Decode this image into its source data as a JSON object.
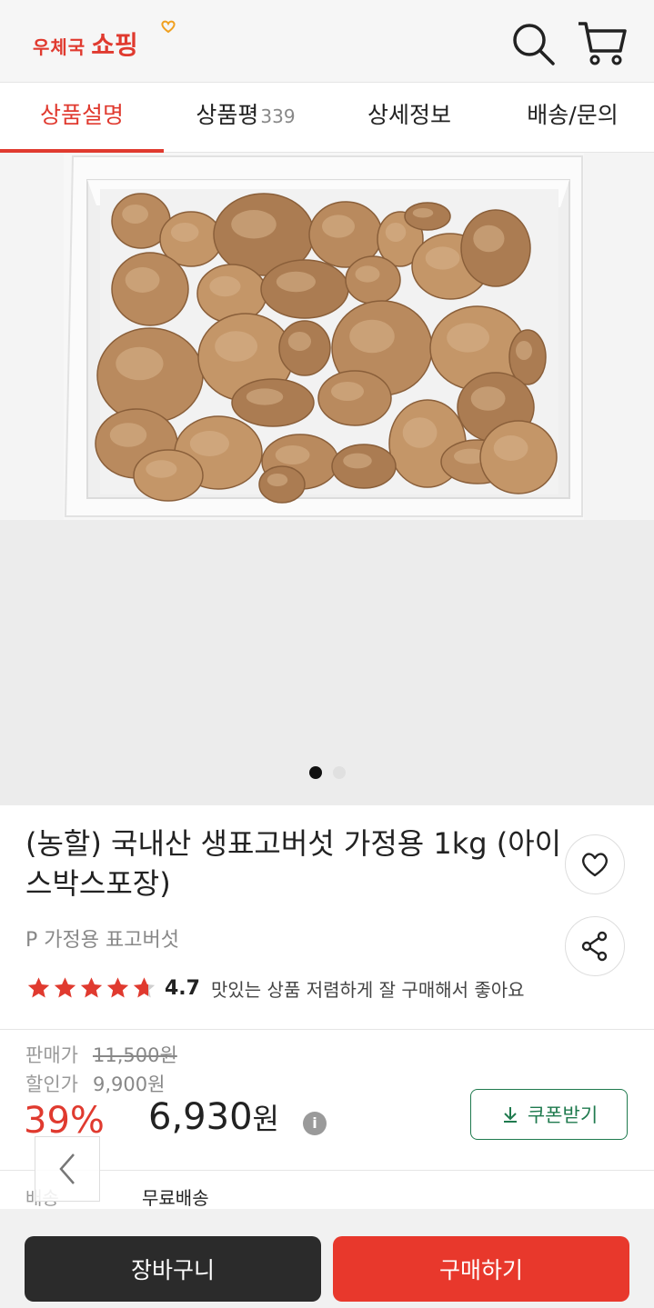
{
  "header": {
    "logo_small": "우체국",
    "logo_big": "쇼핑",
    "search_icon": "search-icon",
    "cart_icon": "cart-icon"
  },
  "tabs": [
    {
      "label": "상품설명",
      "active": true
    },
    {
      "label": "상품평",
      "count": "339"
    },
    {
      "label": "상세정보"
    },
    {
      "label": "배송/문의"
    }
  ],
  "carousel": {
    "image_alt": "mushrooms-in-styrofoam-box",
    "current_page": 1,
    "total_pages": 2
  },
  "product": {
    "title": "(농할) 국내산 생표고버섯 가정용 1kg (아이스박스포장)",
    "category": "P 가정용 표고버섯",
    "rating": "4.7",
    "rating_value": 4.7,
    "review_snippet": "맛있는 상품 저렴하게 잘 구매해서 좋아요"
  },
  "price": {
    "sale_label": "판매가",
    "sale_price": "11,500원",
    "discount_label": "할인가",
    "discount_price": "9,900원",
    "discount_rate": "39%",
    "final_price": "6,930",
    "final_unit": "원",
    "coupon_label": "쿠폰받기"
  },
  "shipping": {
    "label": "배송",
    "value": "무료배송"
  },
  "actions": {
    "cart_label": "장바구니",
    "buy_label": "구매하기"
  },
  "colors": {
    "accent": "#e03a2f",
    "coupon": "#1f7a4e",
    "dark": "#2b2b2b"
  }
}
